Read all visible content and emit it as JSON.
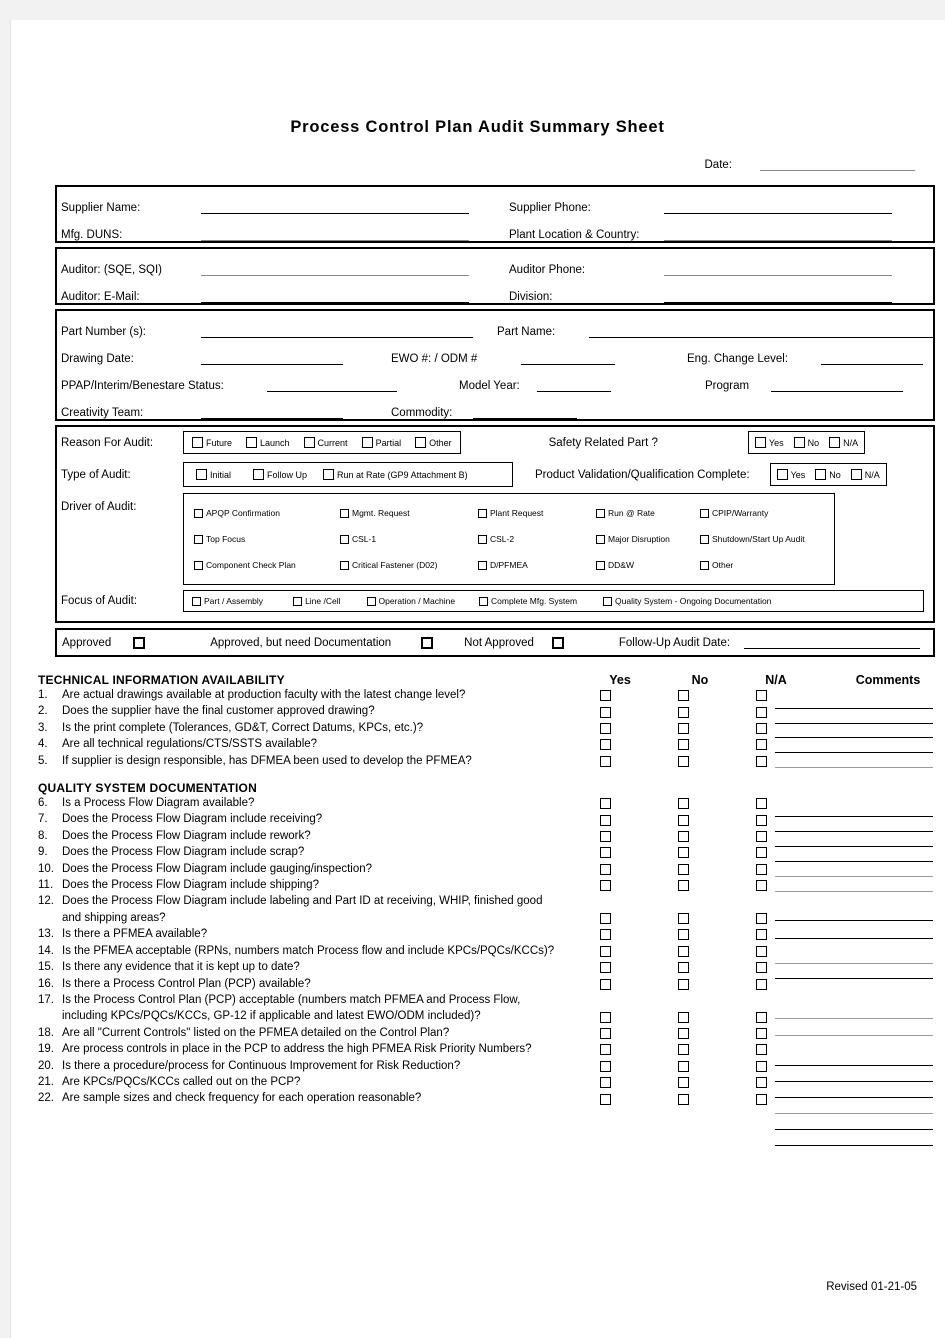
{
  "document": {
    "title": "Process  Control  Plan  Audit  Summary  Sheet",
    "date_label": "Date:",
    "revised": "Revised 01-21-05"
  },
  "supplier_section": {
    "supplier_name_label": "Supplier Name:",
    "mfg_duns_label": "Mfg. DUNS:",
    "supplier_phone_label": "Supplier Phone:",
    "plant_location_label": "Plant Location & Country:"
  },
  "auditor_section": {
    "auditor_label": "Auditor: (SQE, SQI)",
    "auditor_email_label": "Auditor: E-Mail:",
    "auditor_phone_label": "Auditor Phone:",
    "division_label": "Division:"
  },
  "part_section": {
    "part_number_label": "Part Number (s):",
    "part_name_label": "Part Name:",
    "drawing_date_label": "Drawing Date:",
    "ewo_label": "EWO #: / ODM #",
    "eng_change_label": "Eng. Change Level:",
    "ppap_label": "PPAP/Interim/Benestare Status:",
    "model_year_label": "Model Year:",
    "program_label": "Program",
    "creativity_team_label": "Creativity Team:",
    "commodity_label": "Commodity:"
  },
  "audit_section": {
    "reason_label": "Reason For Audit:",
    "reason_options": [
      "Future",
      "Launch",
      "Current",
      "Partial",
      "Other"
    ],
    "type_label": "Type of Audit:",
    "type_options": [
      "Initial",
      "Follow Up",
      "Run at Rate (GP9 Attachment B)"
    ],
    "safety_label": "Safety Related Part ?",
    "validation_label": "Product Validation/Qualification Complete:",
    "yn_options": [
      "Yes",
      "No",
      "N/A"
    ],
    "driver_label": "Driver of Audit:",
    "driver_options": [
      "APQP Confirmation",
      "Mgmt. Request",
      "Plant Request",
      "Run @ Rate",
      "CPIP/Warranty",
      "Top Focus",
      "CSL-1",
      "CSL-2",
      "Major Disruption",
      "Shutdown/Start Up Audit",
      "Component Check Plan",
      "Critical Fastener (D02)",
      "D/PFMEA",
      "DD&W",
      "Other"
    ],
    "focus_label": "Focus of Audit:",
    "focus_options": [
      "Part / Assembly",
      "Line /Cell",
      "Operation / Machine",
      "Complete Mfg. System",
      "Quality System - Ongoing Documentation"
    ]
  },
  "approval_section": {
    "approved_label": "Approved",
    "approved_doc_label": "Approved, but need Documentation",
    "not_approved_label": "Not Approved",
    "followup_label": "Follow-Up Audit Date:"
  },
  "questions": {
    "columns": [
      "Yes",
      "No",
      "N/A",
      "Comments"
    ],
    "sections": [
      {
        "heading": "TECHNICAL INFORMATION AVAILABILITY",
        "items": [
          {
            "num": "1.",
            "text": "Are actual drawings available at production faculty with the latest change level?"
          },
          {
            "num": "2.",
            "text": "Does the supplier have the final customer approved drawing?"
          },
          {
            "num": "3.",
            "text": "Is the print complete (Tolerances, GD&T, Correct Datums, KPCs, etc.)?"
          },
          {
            "num": "4.",
            "text": "Are all technical regulations/CTS/SSTS available?"
          },
          {
            "num": "5.",
            "text": "If supplier is design responsible, has DFMEA been used to develop the PFMEA?"
          }
        ]
      },
      {
        "heading": "QUALITY SYSTEM DOCUMENTATION",
        "items": [
          {
            "num": "6.",
            "text": "Is a Process Flow Diagram available?"
          },
          {
            "num": "7.",
            "text": "Does the Process Flow Diagram include receiving?"
          },
          {
            "num": "8.",
            "text": "Does the Process Flow Diagram include rework?"
          },
          {
            "num": "9.",
            "text": "Does the Process Flow Diagram include scrap?"
          },
          {
            "num": "10.",
            "text": "Does the Process Flow Diagram include gauging/inspection?"
          },
          {
            "num": "11.",
            "text": "Does the Process Flow Diagram include shipping?"
          },
          {
            "num": "12.",
            "text": "Does the Process Flow Diagram include labeling and Part ID at receiving, WHIP, finished good and shipping areas?"
          },
          {
            "num": "13.",
            "text": "Is there a PFMEA available?"
          },
          {
            "num": "14.",
            "text": "Is the PFMEA acceptable (RPNs, numbers match Process flow and include KPCs/PQCs/KCCs)?"
          },
          {
            "num": "15.",
            "text": "Is there any evidence that it is kept up to date?"
          },
          {
            "num": "16.",
            "text": "Is there a Process Control Plan (PCP) available?"
          },
          {
            "num": "17.",
            "text": "Is the Process Control Plan (PCP) acceptable (numbers match PFMEA and Process Flow, including KPCs/PQCs/KCCs, GP-12 if applicable and latest EWO/ODM included)?"
          },
          {
            "num": "18.",
            "text": "Are all \"Current Controls\" listed on the PFMEA detailed on the Control Plan?"
          },
          {
            "num": "19.",
            "text": "Are process controls in place in the PCP to address the high PFMEA Risk Priority Numbers?"
          },
          {
            "num": "20.",
            "text": "Is there a procedure/process for Continuous Improvement for Risk Reduction?"
          },
          {
            "num": "21.",
            "text": "Are KPCs/PQCs/KCCs called out on the PCP?"
          },
          {
            "num": "22.",
            "text": "Are sample sizes and check frequency for each operation reasonable?"
          }
        ]
      }
    ]
  }
}
